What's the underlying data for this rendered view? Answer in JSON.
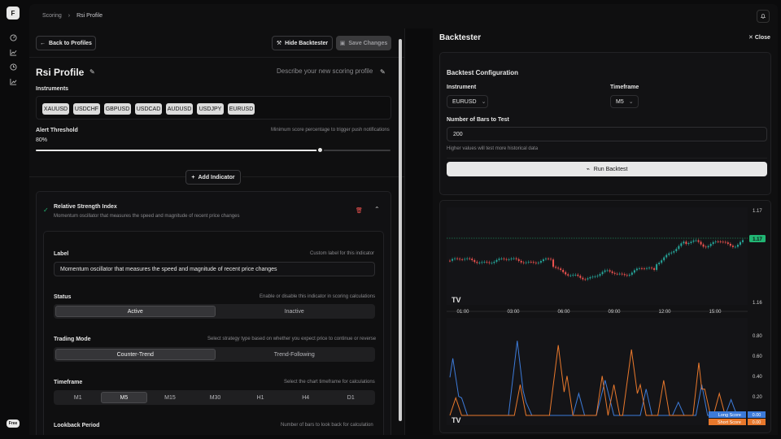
{
  "app": {
    "logo_letter": "F",
    "plan_badge": "Free"
  },
  "sidebar": {
    "icons": [
      "gauge-icon",
      "chart-line-icon",
      "clock-icon",
      "trend-chart-icon"
    ]
  },
  "breadcrumb": {
    "root": "Scoring",
    "current": "Rsi Profile"
  },
  "toolbar": {
    "back_label": "Back to Profiles",
    "hide_backtester_label": "Hide Backtester",
    "save_label": "Save Changes"
  },
  "profile": {
    "name": "Rsi Profile",
    "description_placeholder": "Describe your new scoring profile",
    "instruments_label": "Instruments",
    "instruments": [
      "XAUUSD",
      "USDCHF",
      "GBPUSD",
      "USDCAD",
      "AUDUSD",
      "USDJPY",
      "EURUSD"
    ],
    "alert_label": "Alert Threshold",
    "alert_hint": "Minimum score percentage to trigger push notifications",
    "alert_value": "80%",
    "alert_fraction": 0.8,
    "add_indicator_label": "Add Indicator"
  },
  "indicator": {
    "title": "Relative Strength Index",
    "subtitle": "Momentum oscillator that measures the speed and magnitude of recent price changes",
    "label_label": "Label",
    "label_hint": "Custom label for this indicator",
    "label_value": "Momentum oscillator that measures the speed and magnitude of recent price changes",
    "status_label": "Status",
    "status_hint": "Enable or disable this indicator in scoring calculations",
    "status_options": [
      "Active",
      "Inactive"
    ],
    "status_selected": "Active",
    "mode_label": "Trading Mode",
    "mode_hint": "Select strategy type based on whether you expect price to continue or reverse",
    "mode_options": [
      "Counter-Trend",
      "Trend-Following"
    ],
    "mode_selected": "Counter-Trend",
    "timeframe_label": "Timeframe",
    "timeframe_hint": "Select the chart timeframe for calculations",
    "timeframe_options": [
      "M1",
      "M5",
      "M15",
      "M30",
      "H1",
      "H4",
      "D1"
    ],
    "timeframe_selected": "M5",
    "lookback_label": "Lookback Period",
    "lookback_hint": "Number of bars to look back for calculation"
  },
  "backtester": {
    "title": "Backtester",
    "close_label": "Close",
    "config_title": "Backtest Configuration",
    "instrument_label": "Instrument",
    "instrument_value": "EURUSD",
    "timeframe_label": "Timeframe",
    "timeframe_value": "M5",
    "bars_label": "Number of Bars to Test",
    "bars_value": "200",
    "bars_hint": "Higher values will test more historical data",
    "run_label": "Run Backtest"
  },
  "chart_data": [
    {
      "type": "candlestick",
      "price_labels": [
        "1.17",
        "1.16"
      ],
      "last_price_label": "1.17",
      "time_labels": [
        "01:00",
        "03:00",
        "06:00",
        "09:00",
        "12:00",
        "15:00"
      ],
      "grid": false
    },
    {
      "type": "line",
      "y_labels": [
        "0.80",
        "0.60",
        "0.40",
        "0.20"
      ],
      "series": [
        {
          "name": "Long Score",
          "last_value": "0.00",
          "color": "#3d7bd9"
        },
        {
          "name": "Short Score",
          "last_value": "0.00",
          "color": "#e8782c"
        }
      ]
    }
  ],
  "colors": {
    "up": "#26a69a",
    "down": "#ef5350",
    "accent_green": "#21b573",
    "long": "#3d7bd9",
    "short": "#e8782c"
  }
}
